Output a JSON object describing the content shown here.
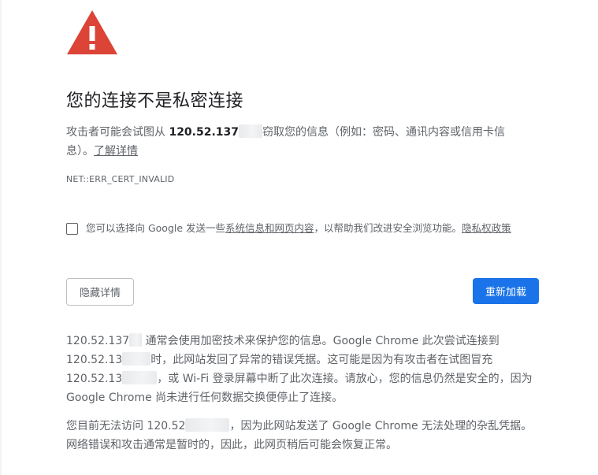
{
  "heading": "您的连接不是私密连接",
  "explanation": {
    "prefix": "攻击者可能会试图从 ",
    "host": "120.52.137",
    "suffix": "窃取您的信息（例如：密码、通讯内容或信用卡信息）。",
    "learn_more": "了解详情"
  },
  "error_code": "NET::ERR_CERT_INVALID",
  "optin": {
    "prefix": "您可以选择向 Google 发送一些",
    "link": "系统信息和网页内容",
    "middle": "，以帮助我们改进安全浏览功能。",
    "privacy_link": "隐私权政策"
  },
  "buttons": {
    "details": "隐藏详情",
    "reload": "重新加载"
  },
  "details": {
    "p1_host1": "120.52.137",
    "p1_text1": " 通常会使用加密技术来保护您的信息。Google Chrome 此次尝试连接到",
    "p1_host2": "120.52.13",
    "p1_text2": "时，此网站发回了异常的错误凭据。这可能是因为有攻击者在试图冒充",
    "p1_host3": "120.52.13",
    "p1_text3": "，或 Wi-Fi 登录屏幕中断了此次连接。请放心，您的信息仍然是安全的，因为 Google Chrome 尚未进行任何数据交换便停止了连接。",
    "p2_prefix": "您目前无法访问 ",
    "p2_host": "120.52",
    "p2_text": "，因为此网站发送了 Google Chrome 无法处理的杂乱凭据。网络错误和攻击通常是暂时的，因此，此网页稍后可能会恢复正常。"
  },
  "colors": {
    "warning_red": "#db4437",
    "primary_blue": "#1a73e8",
    "heading_text": "#202124",
    "body_text": "#5f6368"
  }
}
